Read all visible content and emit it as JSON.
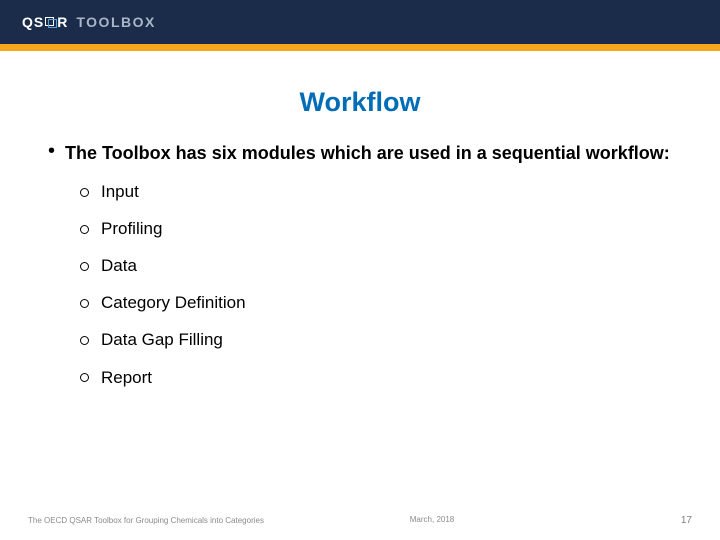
{
  "header": {
    "logo_qsar_left": "QS",
    "logo_qsar_right": "R",
    "logo_toolbox": "TOOLBOX"
  },
  "slide": {
    "title": "Workflow",
    "lead": "The Toolbox has six modules which are used in a sequential workflow:",
    "items": [
      "Input",
      "Profiling",
      "Data",
      "Category Definition",
      "Data Gap Filling",
      "Report"
    ]
  },
  "footer": {
    "left": "The OECD QSAR Toolbox for Grouping Chemicals into Categories",
    "date": "March, 2018",
    "page": "17"
  }
}
